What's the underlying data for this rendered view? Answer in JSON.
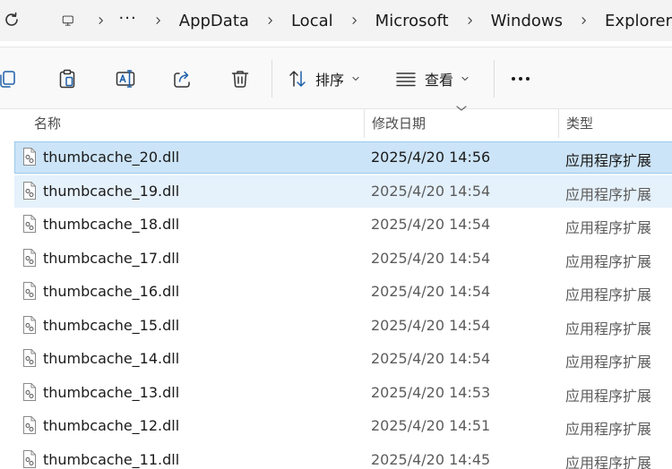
{
  "address_bar": {
    "ellipsis": "···",
    "crumbs": [
      "AppData",
      "Local",
      "Microsoft",
      "Windows",
      "Explorer"
    ]
  },
  "command_bar": {
    "sort_label": "排序",
    "view_label": "查看"
  },
  "columns": {
    "name": "名称",
    "date_modified": "修改日期",
    "type": "类型"
  },
  "files": [
    {
      "name": "thumbcache_20.dll",
      "date": "2025/4/20 14:56",
      "type": "应用程序扩展",
      "state": "selected"
    },
    {
      "name": "thumbcache_19.dll",
      "date": "2025/4/20 14:54",
      "type": "应用程序扩展",
      "state": "hover"
    },
    {
      "name": "thumbcache_18.dll",
      "date": "2025/4/20 14:54",
      "type": "应用程序扩展",
      "state": "normal"
    },
    {
      "name": "thumbcache_17.dll",
      "date": "2025/4/20 14:54",
      "type": "应用程序扩展",
      "state": "normal"
    },
    {
      "name": "thumbcache_16.dll",
      "date": "2025/4/20 14:54",
      "type": "应用程序扩展",
      "state": "normal"
    },
    {
      "name": "thumbcache_15.dll",
      "date": "2025/4/20 14:54",
      "type": "应用程序扩展",
      "state": "normal"
    },
    {
      "name": "thumbcache_14.dll",
      "date": "2025/4/20 14:54",
      "type": "应用程序扩展",
      "state": "normal"
    },
    {
      "name": "thumbcache_13.dll",
      "date": "2025/4/20 14:53",
      "type": "应用程序扩展",
      "state": "normal"
    },
    {
      "name": "thumbcache_12.dll",
      "date": "2025/4/20 14:51",
      "type": "应用程序扩展",
      "state": "normal"
    },
    {
      "name": "thumbcache_11.dll",
      "date": "2025/4/20 14:45",
      "type": "应用程序扩展",
      "state": "normal"
    }
  ],
  "icons": {
    "refresh": "refresh-icon",
    "computer": "computer-icon",
    "chevron": "chevron-right-icon",
    "copy": "copy-icon",
    "paste": "paste-icon",
    "rename": "rename-icon",
    "share": "share-icon",
    "delete": "delete-icon",
    "sort": "sort-icon",
    "view": "view-icon",
    "more": "more-options-icon",
    "file": "dll-file-icon"
  },
  "colors": {
    "accent": "#0067c0",
    "selected_bg": "#cce4f7",
    "selected_border": "#99c9ef",
    "hover_bg": "#e5f1fb"
  }
}
